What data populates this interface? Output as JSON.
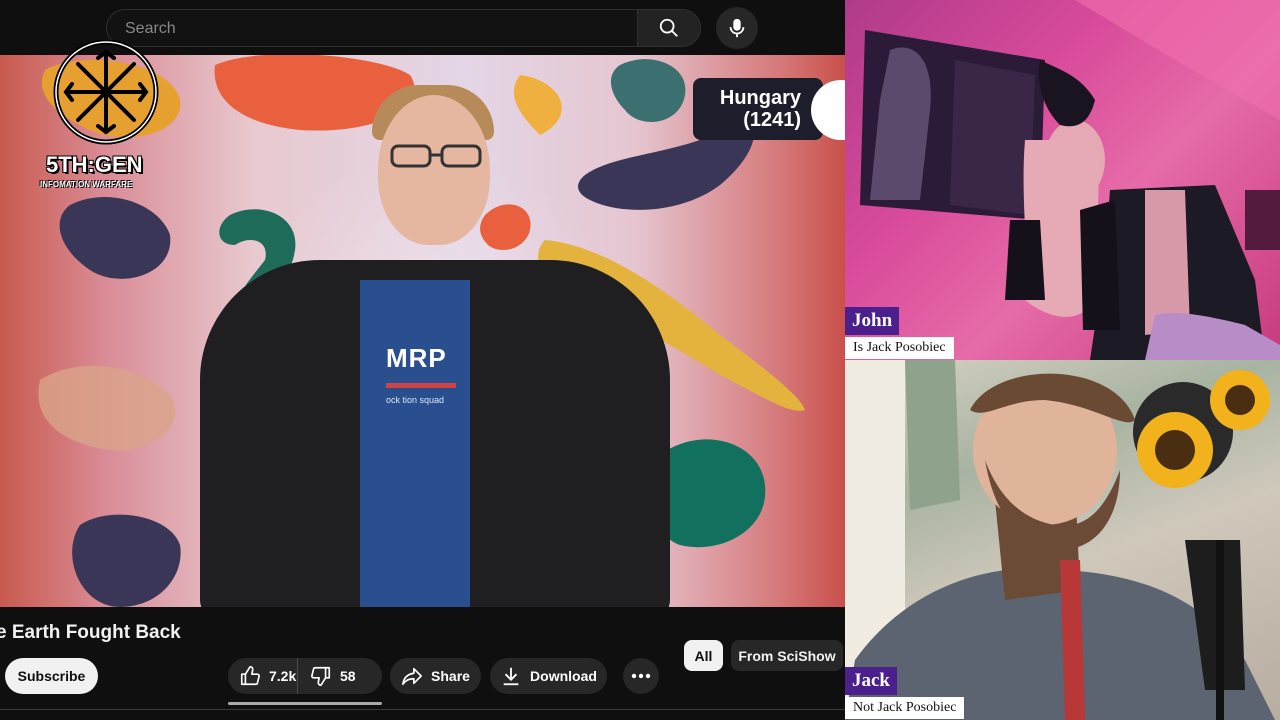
{
  "search": {
    "placeholder": "Search"
  },
  "overlay": {
    "region_name": "Hungary",
    "region_year": "(1241)",
    "logo_name": "5TH:GEN",
    "logo_tagline": "INFOMATION WARFARE",
    "shirt_text": "MRP",
    "shirt_sub": "ock tion squad"
  },
  "video": {
    "title": "e Earth Fought Back",
    "subscribe_label": "Subscribe",
    "like_count": "7.2k",
    "dislike_count": "58",
    "share_label": "Share",
    "download_label": "Download"
  },
  "chips": {
    "all": "All",
    "from": "From SciShow"
  },
  "participants": [
    {
      "name": "John",
      "caption": "Is Jack Posobiec"
    },
    {
      "name": "Jack",
      "caption": "Not Jack Posobiec"
    }
  ],
  "colors": {
    "name_tag": "#4b1f8c",
    "youtube_bg": "#0f0f0f",
    "chip_bg": "#272727"
  },
  "icons": [
    "search-icon",
    "mic-icon",
    "like-icon",
    "dislike-icon",
    "share-icon",
    "download-icon",
    "more-icon",
    "fifth-gen-logo-icon"
  ]
}
